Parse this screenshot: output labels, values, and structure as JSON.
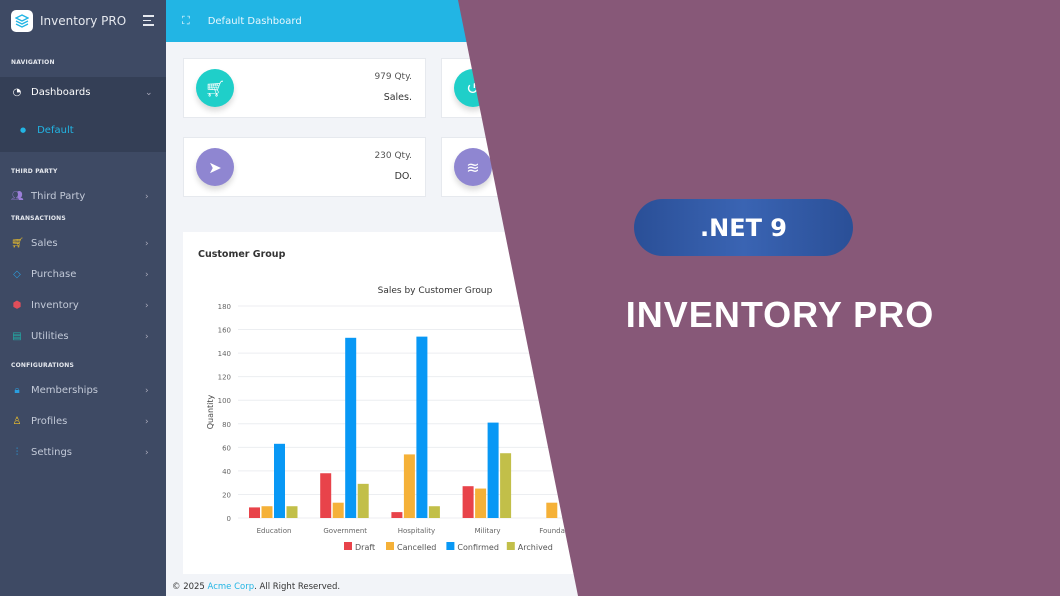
{
  "sidebar": {
    "brand": "Inventory PRO",
    "sections": {
      "navigation": "NAVIGATION",
      "third_party": "THIRD PARTY",
      "transactions": "TRANSACTIONS",
      "configurations": "CONFIGURATIONS"
    },
    "items": {
      "dashboards": "Dashboards",
      "default": "Default",
      "third_party": "Third Party",
      "sales": "Sales",
      "purchase": "Purchase",
      "inventory": "Inventory",
      "utilities": "Utilities",
      "memberships": "Memberships",
      "profiles": "Profiles",
      "settings": "Settings"
    }
  },
  "header": {
    "title": "Default Dashboard"
  },
  "cards": [
    {
      "qty": "979 Qty.",
      "label": "Sales.",
      "icon": "cart-icon",
      "color": "#1fcfc9"
    },
    {
      "qty": "230 Qty.",
      "label": "DO.",
      "icon": "send-icon",
      "color": "#8f86d1"
    },
    {
      "icon": "undo-icon",
      "color": "#1fcfc9"
    },
    {
      "icon": "layers-icon",
      "color": "#8f86d1"
    }
  ],
  "panel": {
    "title": "Customer Group"
  },
  "chart_data": {
    "type": "bar",
    "title": "Sales by Customer Group",
    "ylabel": "Quantity",
    "xlabel": "",
    "ylim": [
      0,
      180
    ],
    "yticks": [
      0,
      20,
      40,
      60,
      80,
      100,
      120,
      140,
      160,
      180
    ],
    "grid": true,
    "legend": "bottom",
    "categories": [
      "Education",
      "Government",
      "Hospitality",
      "Military",
      "Foundation"
    ],
    "series": [
      {
        "name": "Draft",
        "color": "#e8434a",
        "values": [
          9,
          38,
          5,
          27,
          0
        ]
      },
      {
        "name": "Cancelled",
        "color": "#f5b138",
        "values": [
          10,
          13,
          54,
          25,
          13
        ]
      },
      {
        "name": "Confirmed",
        "color": "#0898f5",
        "values": [
          63,
          153,
          154,
          81,
          null
        ]
      },
      {
        "name": "Archived",
        "color": "#c2bf49",
        "values": [
          10,
          29,
          10,
          55,
          null
        ]
      }
    ]
  },
  "footer": {
    "prefix": "© 2025 ",
    "company": "Acme Corp",
    "suffix": ". All Right Reserved."
  },
  "promo": {
    "badge": ".NET 9",
    "title": "INVENTORY PRO",
    "color": "#875878"
  }
}
